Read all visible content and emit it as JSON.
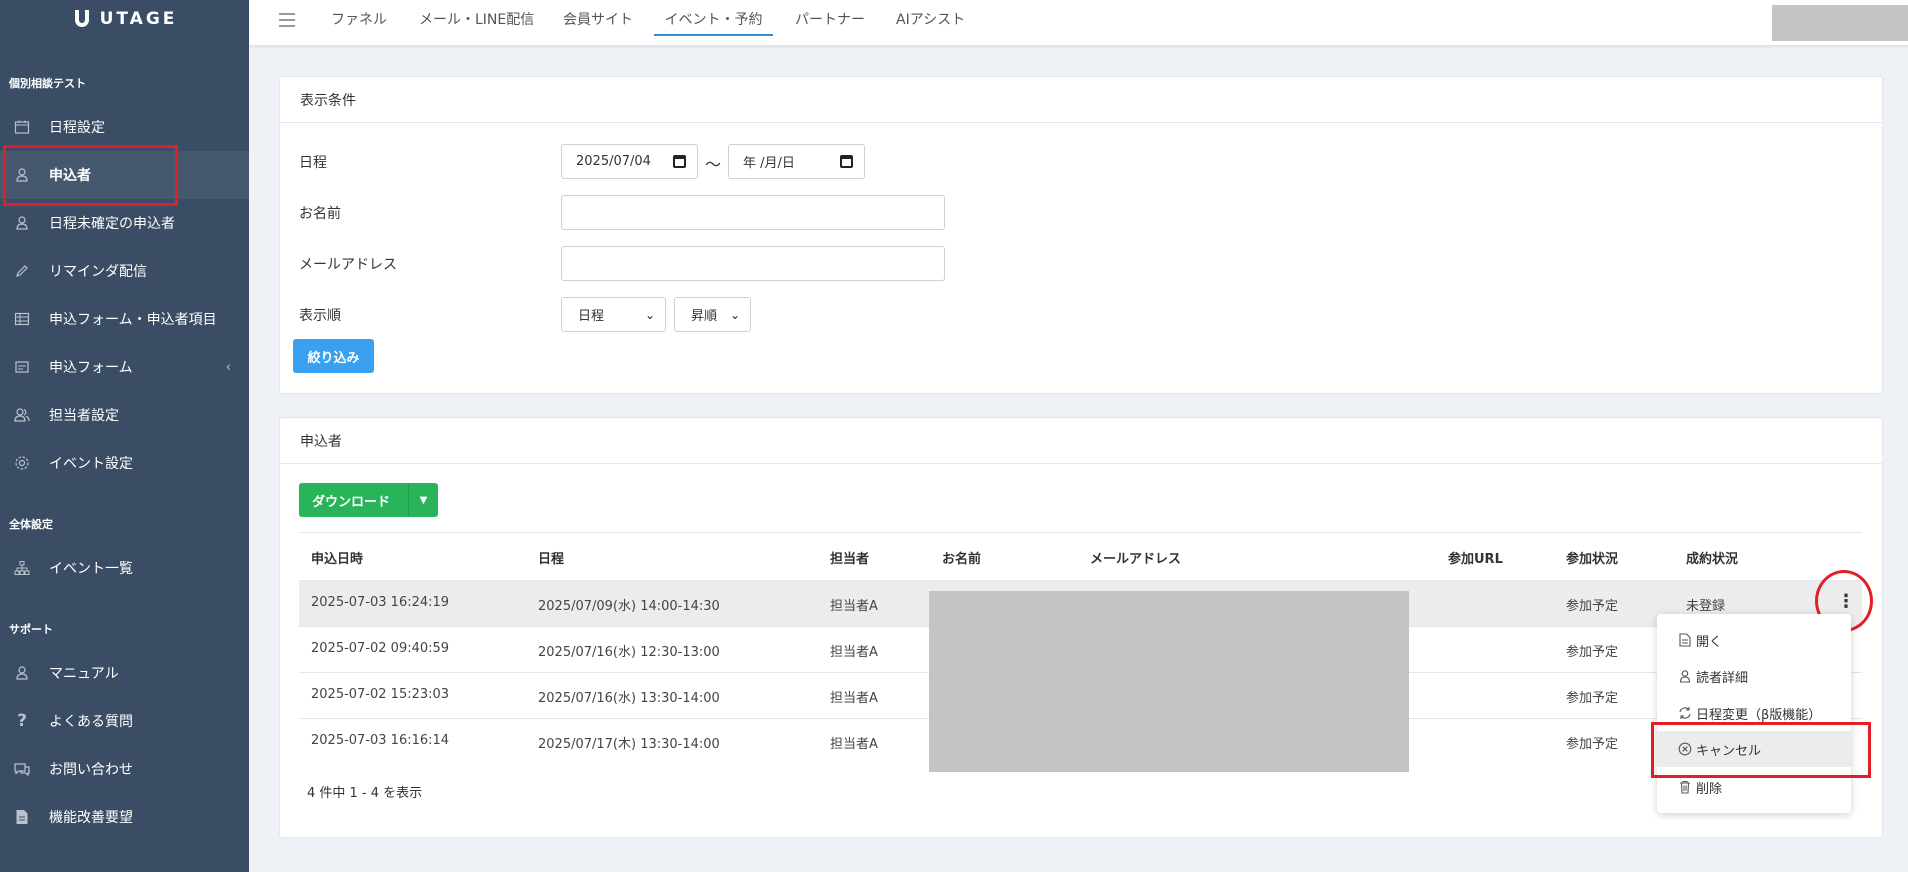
{
  "app": {
    "logo_text": "UTAGE"
  },
  "topnav": {
    "tabs": [
      {
        "label": "ファネル"
      },
      {
        "label": "メール・LINE配信"
      },
      {
        "label": "会員サイト"
      },
      {
        "label": "イベント・予約"
      },
      {
        "label": "パートナー"
      },
      {
        "label": "AIアシスト"
      }
    ],
    "active_tab": "イベント・予約"
  },
  "sidebar": {
    "section_event": "個別相談テスト",
    "items_event": [
      {
        "label": "日程設定",
        "icon": "calendar-icon"
      },
      {
        "label": "申込者",
        "icon": "person-icon"
      },
      {
        "label": "日程未確定の申込者",
        "icon": "person-icon"
      },
      {
        "label": "リマインダ配信",
        "icon": "pencil-icon"
      },
      {
        "label": "申込フォーム・申込者項目",
        "icon": "table-icon"
      },
      {
        "label": "申込フォーム",
        "icon": "form-icon"
      },
      {
        "label": "担当者設定",
        "icon": "people-icon"
      },
      {
        "label": "イベント設定",
        "icon": "gear-icon"
      }
    ],
    "section_global": "全体設定",
    "items_global": [
      {
        "label": "イベント一覧",
        "icon": "sitemap-icon"
      }
    ],
    "section_support": "サポート",
    "items_support": [
      {
        "label": "マニュアル",
        "icon": "person-icon"
      },
      {
        "label": "よくある質問",
        "icon": "question-icon"
      },
      {
        "label": "お問い合わせ",
        "icon": "chat-icon"
      },
      {
        "label": "機能改善要望",
        "icon": "document-icon"
      }
    ],
    "active_item": "申込者"
  },
  "filter": {
    "title": "表示条件",
    "date_label": "日程",
    "date_from": "2025/07/04",
    "date_to_placeholder": "年 /月/日",
    "range_sep": "〜",
    "name_label": "お名前",
    "email_label": "メールアドレス",
    "order_label": "表示順",
    "order_field": "日程",
    "order_dir": "昇順",
    "submit": "絞り込み"
  },
  "applicants": {
    "title": "申込者",
    "download": "ダウンロード",
    "columns": [
      "申込日時",
      "日程",
      "担当者",
      "お名前",
      "メールアドレス",
      "参加URL",
      "参加状況",
      "成約状況"
    ],
    "rows": [
      {
        "applied": "2025-07-03 16:24:19",
        "schedule": "2025/07/09(水) 14:00-14:30",
        "staff": "担当者A",
        "status": "参加予定",
        "deal": "未登録"
      },
      {
        "applied": "2025-07-02 09:40:59",
        "schedule": "2025/07/16(水) 12:30-13:00",
        "staff": "担当者A",
        "status": "参加予定",
        "deal": ""
      },
      {
        "applied": "2025-07-02 15:23:03",
        "schedule": "2025/07/16(水) 13:30-14:00",
        "staff": "担当者A",
        "status": "参加予定",
        "deal": ""
      },
      {
        "applied": "2025-07-03 16:16:14",
        "schedule": "2025/07/17(木) 13:30-14:00",
        "staff": "担当者A",
        "status": "参加予定",
        "deal": ""
      }
    ],
    "footer": "4 件中 1 - 4 を表示"
  },
  "row_menu": {
    "items": [
      {
        "label": "開く",
        "icon": "document-icon"
      },
      {
        "label": "読者詳細",
        "icon": "person-icon"
      },
      {
        "label": "日程変更（β版機能）",
        "icon": "refresh-icon"
      },
      {
        "label": "キャンセル",
        "icon": "cancel-circle-icon"
      },
      {
        "label": "削除",
        "icon": "trash-icon"
      }
    ]
  },
  "colors": {
    "sidebar_bg": "#3a4d64",
    "accent_blue": "#3aa0f0",
    "download_green": "#29b35b",
    "highlight_red": "#e21f26"
  }
}
